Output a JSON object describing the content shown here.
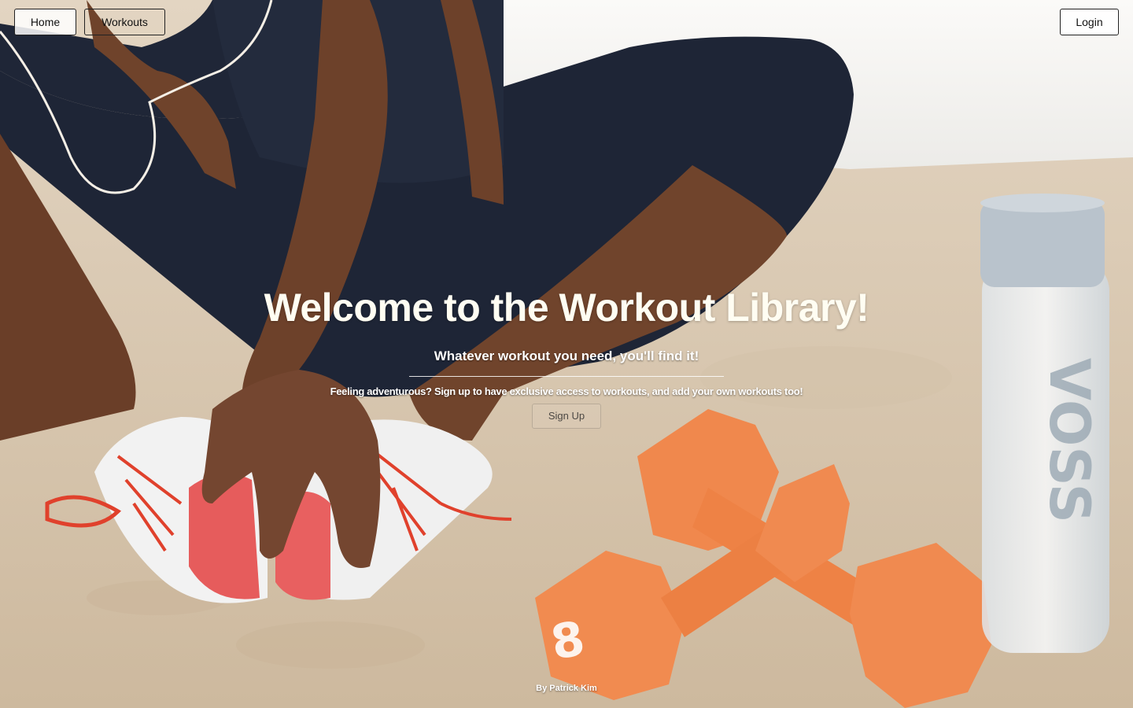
{
  "nav": {
    "home_label": "Home",
    "workouts_label": "Workouts",
    "login_label": "Login"
  },
  "hero": {
    "title": "Welcome to the Workout Library!",
    "subtitle": "Whatever workout you need, you'll find it!",
    "text": "Feeling adventurous? Sign up to have exclusive access to workouts, and add your own workouts too!",
    "signup_label": "Sign Up"
  },
  "footer": {
    "credit": "By Patrick Kim"
  },
  "background": {
    "description_icon": "fitness-photo",
    "colors": {
      "floor": "#d9c9b3",
      "wall": "#f4f2ee",
      "leggings": "#1f2637",
      "skin": "#6b3f28",
      "dumbbell": "#f0884d",
      "shoe_sole": "#e65c5c",
      "laces": "#e0412c",
      "bottle_cap": "#b9c3cc"
    }
  }
}
